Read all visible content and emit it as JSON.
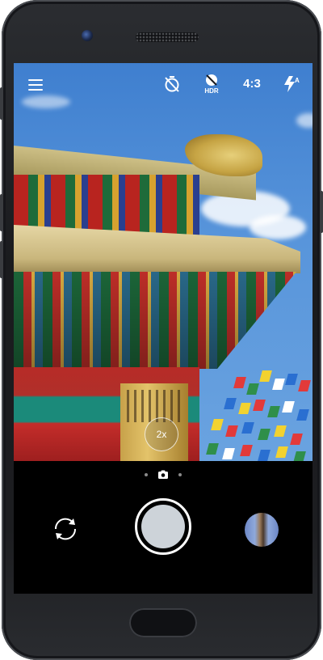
{
  "toolbar": {
    "menu_icon": "hamburger-menu-icon",
    "timer_icon": "timer-off-icon",
    "hdr_label": "HDR",
    "ratio_label": "4:3",
    "flash_icon": "flash-auto-icon",
    "flash_mode_letter": "A"
  },
  "viewfinder": {
    "zoom_label": "2x"
  },
  "modes": {
    "current_icon": "camera-icon",
    "total_pages": 3,
    "current_page": 2
  },
  "controls": {
    "switch_icon": "switch-camera-icon",
    "shutter_icon": "shutter-button",
    "gallery_icon": "gallery-thumbnail"
  },
  "colors": {
    "shutter_fill": "#cdd3d9",
    "control_bg": "#000000",
    "icon_color": "#ffffff"
  }
}
